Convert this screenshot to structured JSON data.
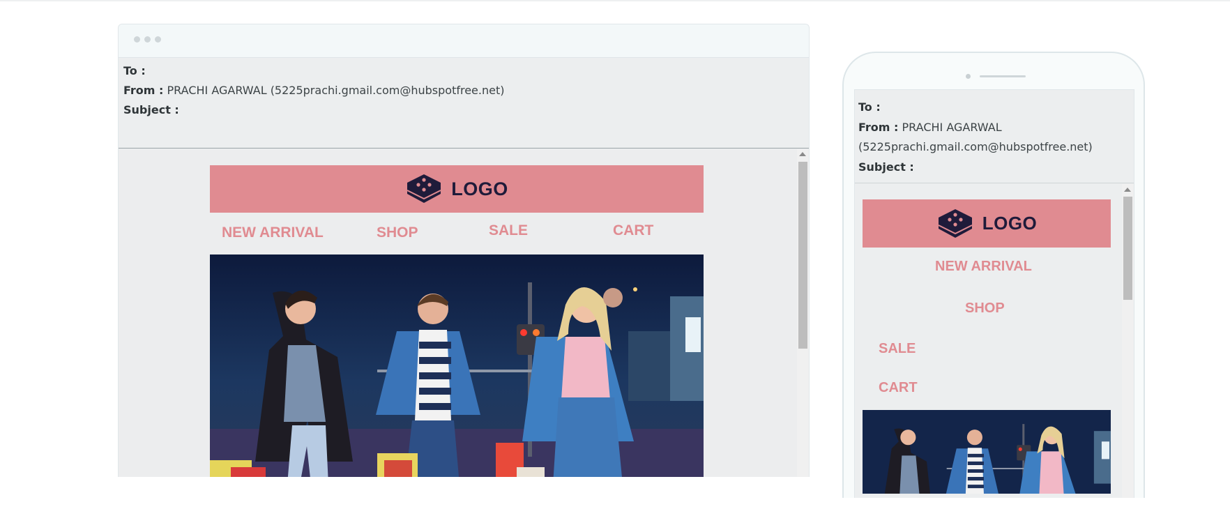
{
  "desktop": {
    "headers": {
      "to_label": "To :",
      "to_value": "",
      "from_label": "From :",
      "from_value": "PRACHI AGARWAL (5225prachi.gmail.com@hubspotfree.net)",
      "subject_label": "Subject :",
      "subject_value": ""
    }
  },
  "mobile": {
    "headers": {
      "to_label": "To :",
      "from_label": "From :",
      "from_name": "PRACHI AGARWAL",
      "from_email": "(5225prachi.gmail.com@hubspotfree.net)",
      "subject_label": "Subject :"
    }
  },
  "email": {
    "logo_text": "LOGO",
    "nav": [
      "NEW ARRIVAL",
      "SHOP",
      "SALE",
      "CART"
    ],
    "hero_image": "night-street-shopping-friends-photo"
  },
  "colors": {
    "brand_pink": "#e08b91",
    "logo_dark": "#1f1b3a",
    "preview_bg": "#eceeef"
  }
}
